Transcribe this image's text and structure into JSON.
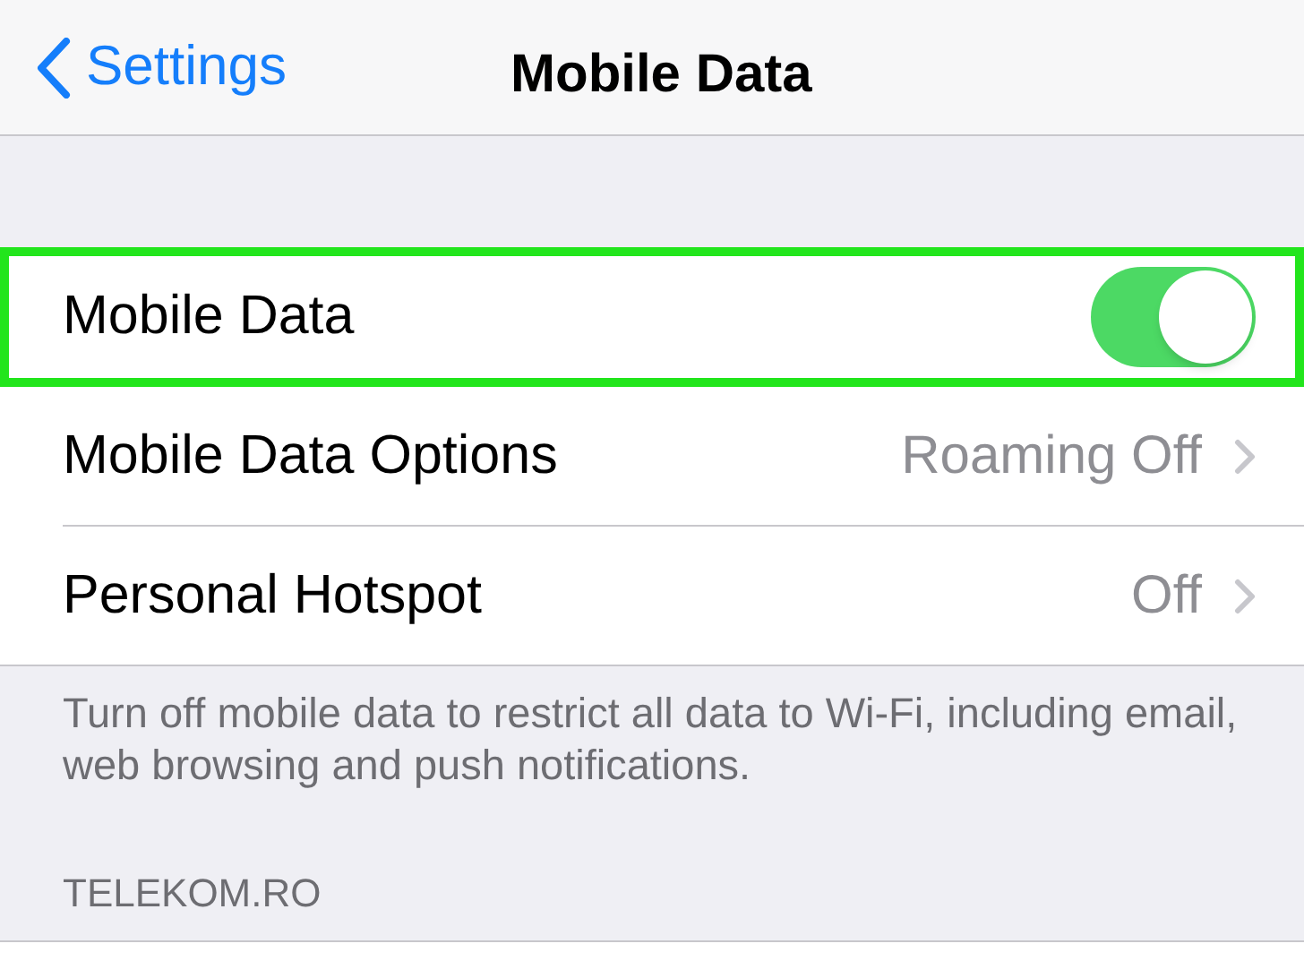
{
  "nav": {
    "back": "Settings",
    "title": "Mobile Data"
  },
  "rows": [
    {
      "kind": "toggle",
      "label": "Mobile Data",
      "on": true,
      "highlighted": true
    },
    {
      "kind": "link",
      "label": "Mobile Data Options",
      "value": "Roaming Off",
      "highlighted": false
    },
    {
      "kind": "link",
      "label": "Personal Hotspot",
      "value": "Off",
      "highlighted": false
    }
  ],
  "footer": "Turn off mobile data to restrict all data to Wi-Fi, including email, web browsing and push notifications.",
  "section_header": "TELEKOM.RO"
}
